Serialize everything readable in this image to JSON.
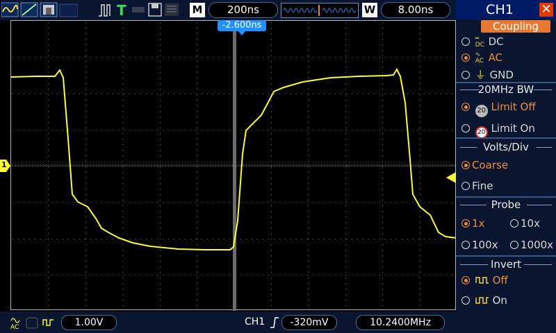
{
  "topbar": {
    "mode_badge": "M",
    "timebase": "200ns",
    "trigger_pos_badge": "W",
    "window": "8.00ns",
    "trigger_offset": "-2.600ns"
  },
  "screen": {
    "channel_marker": "1"
  },
  "bottombar": {
    "volts": "1.00V",
    "trig_channel": "CH1",
    "trig_level": "-320mV",
    "frequency": "10.2400MHz"
  },
  "menu": {
    "title": "CH1",
    "coupling": {
      "label": "Coupling",
      "options": [
        "DC",
        "AC",
        "GND"
      ],
      "selected": "AC"
    },
    "bandwidth": {
      "label": "20MHz BW",
      "options": [
        "Limit Off",
        "Limit On"
      ],
      "selected": "Limit Off"
    },
    "volts_div": {
      "label": "Volts/Div",
      "options": [
        "Coarse",
        "Fine"
      ],
      "selected": "Coarse"
    },
    "probe": {
      "label": "Probe",
      "options": [
        "1x",
        "10x",
        "100x",
        "1000x"
      ],
      "selected": "1x"
    },
    "invert": {
      "label": "Invert",
      "options": [
        "Off",
        "On"
      ],
      "selected": "Off"
    }
  },
  "colors": {
    "trace": "#ffff33",
    "accent": "#f28c3a",
    "trigger": "#1e90ff"
  }
}
